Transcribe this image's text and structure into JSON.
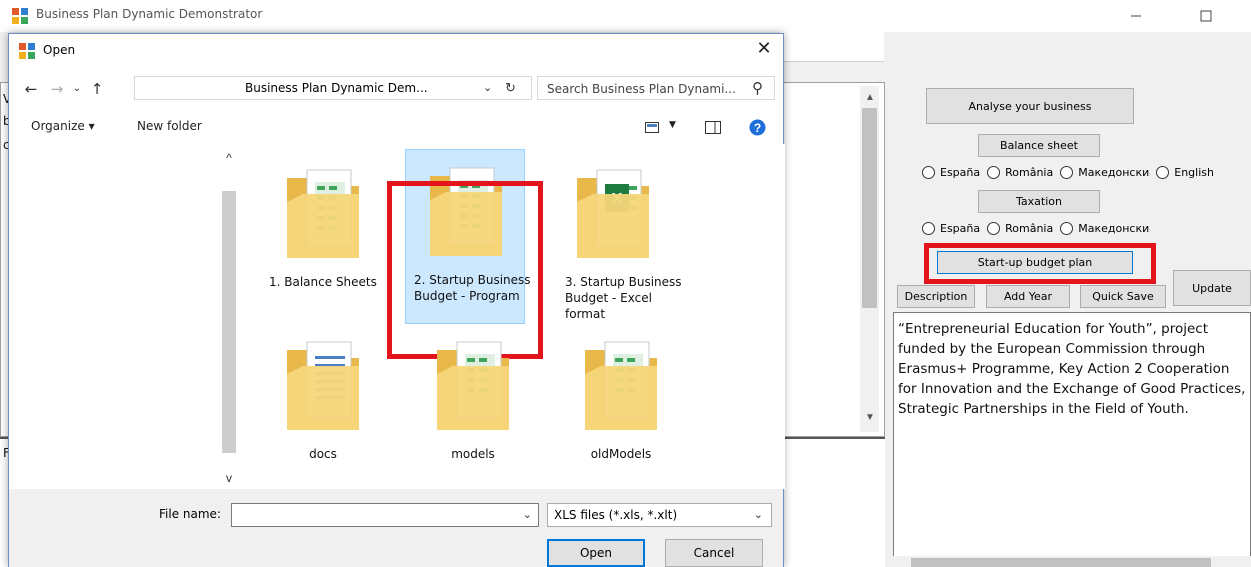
{
  "main_window": {
    "title": "Business Plan Dynamic Demonstrator",
    "buttons": {
      "analyse": "Analyse your business",
      "balance_sheet": "Balance sheet",
      "taxation": "Taxation",
      "startup_budget": "Start-up budget plan",
      "description": "Description",
      "add_year": "Add Year",
      "quick_save": "Quick Save",
      "update": "Update"
    },
    "balance_radios": [
      "España",
      "România",
      "Македонски",
      "English"
    ],
    "taxation_radios": [
      "España",
      "România",
      "Македонски"
    ],
    "description_text": "“Entrepreneurial Education for Youth”, project funded by the European  Commission  through Erasmus+  Programme,  Key Action 2 Cooperation for Innovation and the Exchange of Good Practices, Strategic Partnerships in the Field of Youth.",
    "edge_letters": [
      "V",
      "b",
      "c",
      "F"
    ]
  },
  "dialog": {
    "title": "Open",
    "address": "Business Plan Dynamic Dem...",
    "search_placeholder": "Search Business Plan Dynami...",
    "organize": "Organize ▾",
    "new_folder": "New folder",
    "files": [
      {
        "name": "1. Balance Sheets",
        "kind": "folder-spreadsheet",
        "selected": false
      },
      {
        "name": "2. Startup Business Budget - Program",
        "kind": "folder-spreadsheet",
        "selected": true
      },
      {
        "name": "3. Startup Business Budget - Excel format",
        "kind": "folder-excel",
        "selected": false
      },
      {
        "name": "docs",
        "kind": "folder-document",
        "selected": false
      },
      {
        "name": "models",
        "kind": "folder-spreadsheet",
        "selected": false
      },
      {
        "name": "oldModels",
        "kind": "folder-spreadsheet",
        "selected": false
      }
    ],
    "file_name_label": "File name:",
    "file_name_value": "",
    "filter": "XLS files (*.xls, *.xlt)",
    "open_label": "Open",
    "cancel_label": "Cancel"
  },
  "colors": {
    "highlight_red": "#e3141c",
    "selection_blue": "#cce8ff",
    "accent": "#0078d7"
  }
}
